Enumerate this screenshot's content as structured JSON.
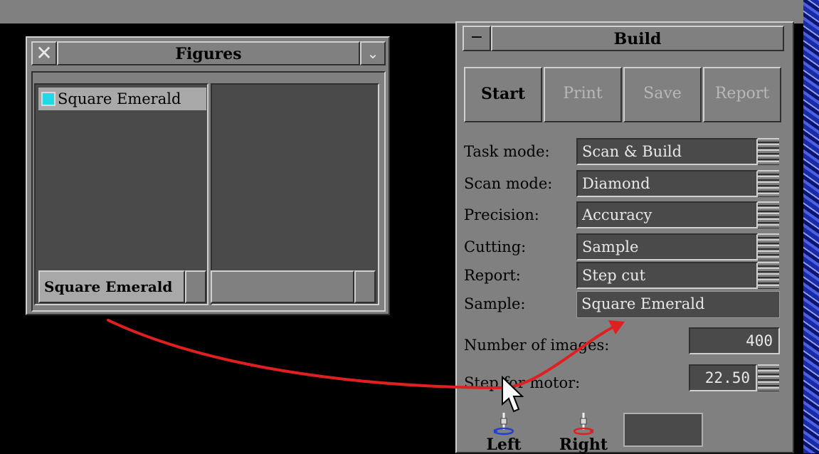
{
  "figures_window": {
    "title": "Figures",
    "list_items": [
      {
        "label": "Square Emerald",
        "swatch_color": "#22d8e8"
      }
    ],
    "selected_field": "Square Emerald"
  },
  "build_panel": {
    "title": "Build",
    "minimize_label": "−",
    "toolbar": [
      {
        "label": "Start",
        "enabled": true
      },
      {
        "label": "Print",
        "enabled": false
      },
      {
        "label": "Save",
        "enabled": false
      },
      {
        "label": "Report",
        "enabled": false
      }
    ],
    "fields": [
      {
        "label": "Task mode:",
        "value": "Scan & Build"
      },
      {
        "label": "Scan mode:",
        "value": "Diamond"
      },
      {
        "label": "Precision:",
        "value": "Accuracy"
      },
      {
        "label": "Cutting:",
        "value": "Sample"
      },
      {
        "label": "Report:",
        "value": "Step cut"
      }
    ],
    "sample": {
      "label": "Sample:",
      "value": "Square Emerald"
    },
    "number_of_images": {
      "label": "Number of images:",
      "value": "400"
    },
    "step_for_motor": {
      "label": "Step for motor:",
      "value": "22.50"
    },
    "motor_left": "Left",
    "motor_right": "Right"
  },
  "colors": {
    "accent_arrow": "#e02020",
    "swatch": "#22d8e8"
  }
}
